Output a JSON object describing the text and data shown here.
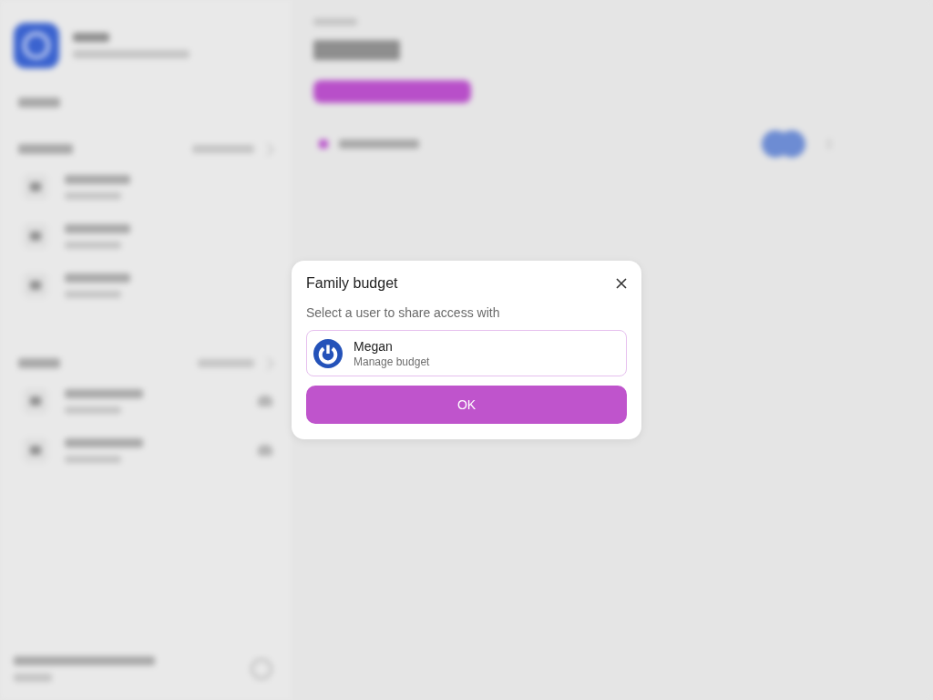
{
  "dialog": {
    "title": "Family budget",
    "prompt": "Select a user to share access with",
    "users": [
      {
        "name": "Megan",
        "role": "Manage budget",
        "selected": true
      }
    ],
    "confirm_button": "OK"
  }
}
